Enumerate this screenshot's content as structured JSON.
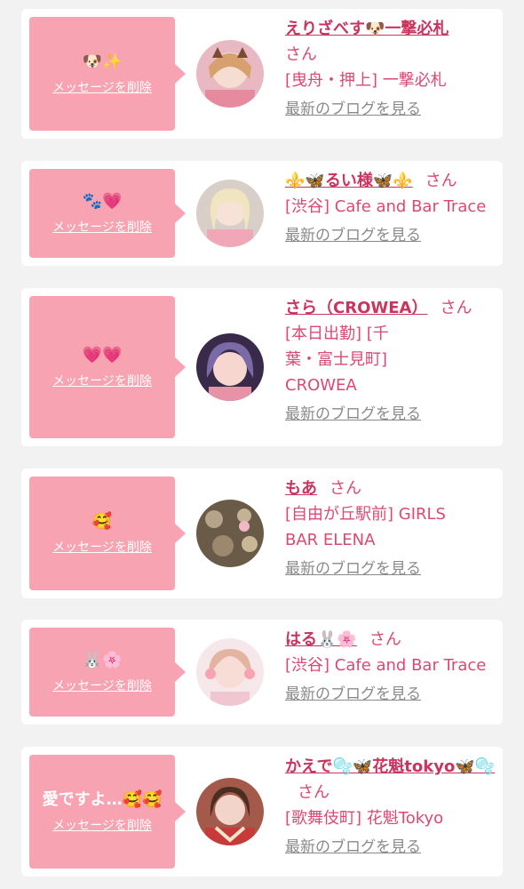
{
  "delete_label": "メッセージを削除",
  "san_label": "さん",
  "blog_label": "最新のブログを見る",
  "colors": {
    "bubble": "#f7a3b2",
    "name": "#c9355f",
    "text": "#d94a73",
    "link_gray": "#8a8a8a",
    "background": "#f2f2f2"
  },
  "items": [
    {
      "message": "🐶✨",
      "name": "えりざべす🐶一撃必札",
      "shop": "[曳舟・押上] 一撃必札",
      "avatar_icon": "photo-avatar-blonde-cat-ears"
    },
    {
      "message": "🐾💗",
      "name": "⚜️🦋るい様🦋⚜️",
      "shop": "[渋谷] Cafe and Bar Trace",
      "avatar_icon": "photo-avatar-blonde"
    },
    {
      "message": "💗💗",
      "name": "さら（CROWEA）",
      "shop": "[本日出勤] [千葉・富士見町] CROWEA",
      "avatar_icon": "photo-avatar-purple-hair"
    },
    {
      "message": "🥰",
      "name": "もあ",
      "shop": "[自由が丘駅前] GIRLS BAR ELENA",
      "avatar_icon": "photo-avatar-bokeh"
    },
    {
      "message": "🐰🌸",
      "name": "はる🐰🌸",
      "shop": "[渋谷] Cafe and Bar Trace",
      "avatar_icon": "photo-avatar-pink"
    },
    {
      "message": "愛ですよ…🥰🥰",
      "name": "かえで🫧🦋花魁tokyo🦋🫧",
      "shop": "[歌舞伎町] 花魁Tokyo",
      "avatar_icon": "photo-avatar-kimono"
    }
  ]
}
